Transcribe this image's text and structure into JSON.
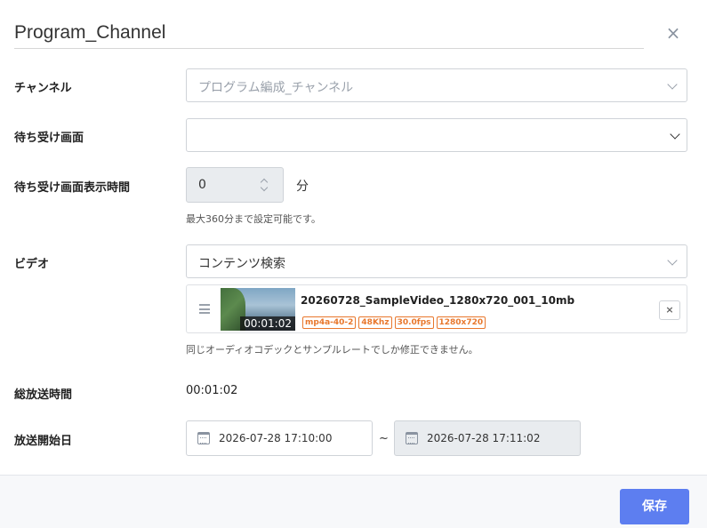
{
  "dialog": {
    "title": "Program_Channel",
    "close_icon": "×"
  },
  "fields": {
    "channel": {
      "label": "チャンネル",
      "placeholder": "プログラム編成_チャンネル"
    },
    "standby_screen": {
      "label": "待ち受け画面",
      "value": ""
    },
    "standby_duration": {
      "label": "待ち受け画面表示時間",
      "value": "0",
      "unit": "分",
      "hint": "最大360分まで設定可能です。"
    },
    "video": {
      "label": "ビデオ",
      "search_placeholder": "コンテンツ検索",
      "items": [
        {
          "name": "20260728_SampleVideo_1280x720_001_10mb",
          "duration": "00:01:02",
          "badges": [
            "mp4a-40-2",
            "48Khz",
            "30.0fps",
            "1280x720"
          ],
          "remove_icon": "×"
        }
      ],
      "hint": "同じオーディオコデックとサンプルレートでしか修正できません。"
    },
    "total_duration": {
      "label": "総放送時間",
      "value": "00:01:02"
    },
    "broadcast_start": {
      "label": "放送開始日",
      "start": "2026-07-28 17:10:00",
      "separator": "~",
      "end": "2026-07-28 17:11:02"
    }
  },
  "footer": {
    "save_label": "保存"
  },
  "colors": {
    "primary": "#5d7ef0",
    "badge": "#e8772c",
    "disabled_bg": "#e9ecef"
  }
}
